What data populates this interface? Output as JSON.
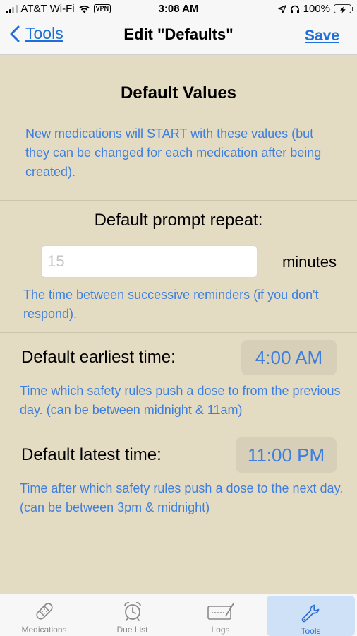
{
  "status_bar": {
    "carrier": "AT&T Wi-Fi",
    "vpn": "VPN",
    "time": "3:08 AM",
    "battery": "100%"
  },
  "nav": {
    "back_label": "Tools",
    "title": "Edit \"Defaults\"",
    "save_label": "Save"
  },
  "defaults": {
    "title": "Default Values",
    "description": "New medications will START with these values (but they can be changed for each medication after being created)."
  },
  "prompt_repeat": {
    "label": "Default prompt repeat:",
    "placeholder": "15",
    "value": "",
    "unit": "minutes",
    "description": "The time between successive reminders (if you don't respond)."
  },
  "earliest_time": {
    "label": "Default earliest time:",
    "value": "4:00 AM",
    "description": "Time which safety rules push a dose to from the previous day. (can be between midnight & 11am)"
  },
  "latest_time": {
    "label": "Default latest time:",
    "value": "11:00 PM",
    "description": "Time after which safety rules push a dose to the next day. (can be between 3pm & midnight)"
  },
  "tabs": [
    {
      "label": "Medications",
      "icon": "bandage-icon",
      "active": false
    },
    {
      "label": "Due List",
      "icon": "alarm-clock-icon",
      "active": false
    },
    {
      "label": "Logs",
      "icon": "logbook-icon",
      "active": false
    },
    {
      "label": "Tools",
      "icon": "wrench-icon",
      "active": true
    }
  ],
  "colors": {
    "background": "#e4dbc3",
    "accent": "#1e6fd9",
    "info_text": "#3d7fe0",
    "time_button_bg": "#d8cfb8",
    "active_tab_bg": "#cfe1f7"
  }
}
